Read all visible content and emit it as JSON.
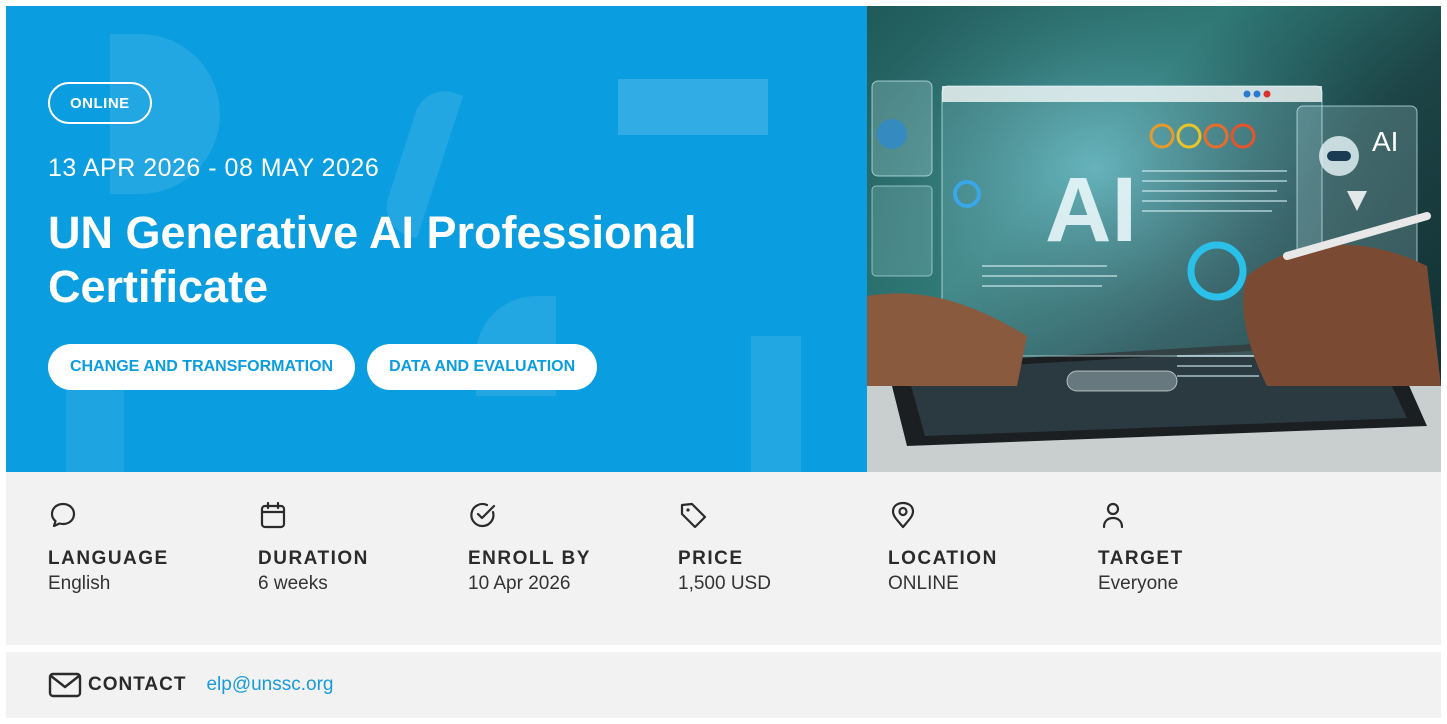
{
  "hero": {
    "mode": "ONLINE",
    "dates": "13 APR 2026 - 08 MAY 2026",
    "title": "UN Generative AI Professional Certificate",
    "topics": [
      "CHANGE AND TRANSFORMATION",
      "DATA AND EVALUATION"
    ],
    "image_text": "AI",
    "accent_color": "#0a9ddf"
  },
  "info": [
    {
      "icon": "speech-bubble-icon",
      "label": "LANGUAGE",
      "value": "English"
    },
    {
      "icon": "calendar-icon",
      "label": "DURATION",
      "value": "6 weeks"
    },
    {
      "icon": "check-circle-icon",
      "label": "ENROLL BY",
      "value": "10 Apr 2026"
    },
    {
      "icon": "price-tag-icon",
      "label": "PRICE",
      "value": "1,500 USD"
    },
    {
      "icon": "location-pin-icon",
      "label": "LOCATION",
      "value": "ONLINE"
    },
    {
      "icon": "user-icon",
      "label": "TARGET",
      "value": "Everyone"
    }
  ],
  "contact": {
    "icon": "envelope-icon",
    "label": "CONTACT",
    "email": "elp@unssc.org",
    "link_color": "#1a9bd7"
  }
}
